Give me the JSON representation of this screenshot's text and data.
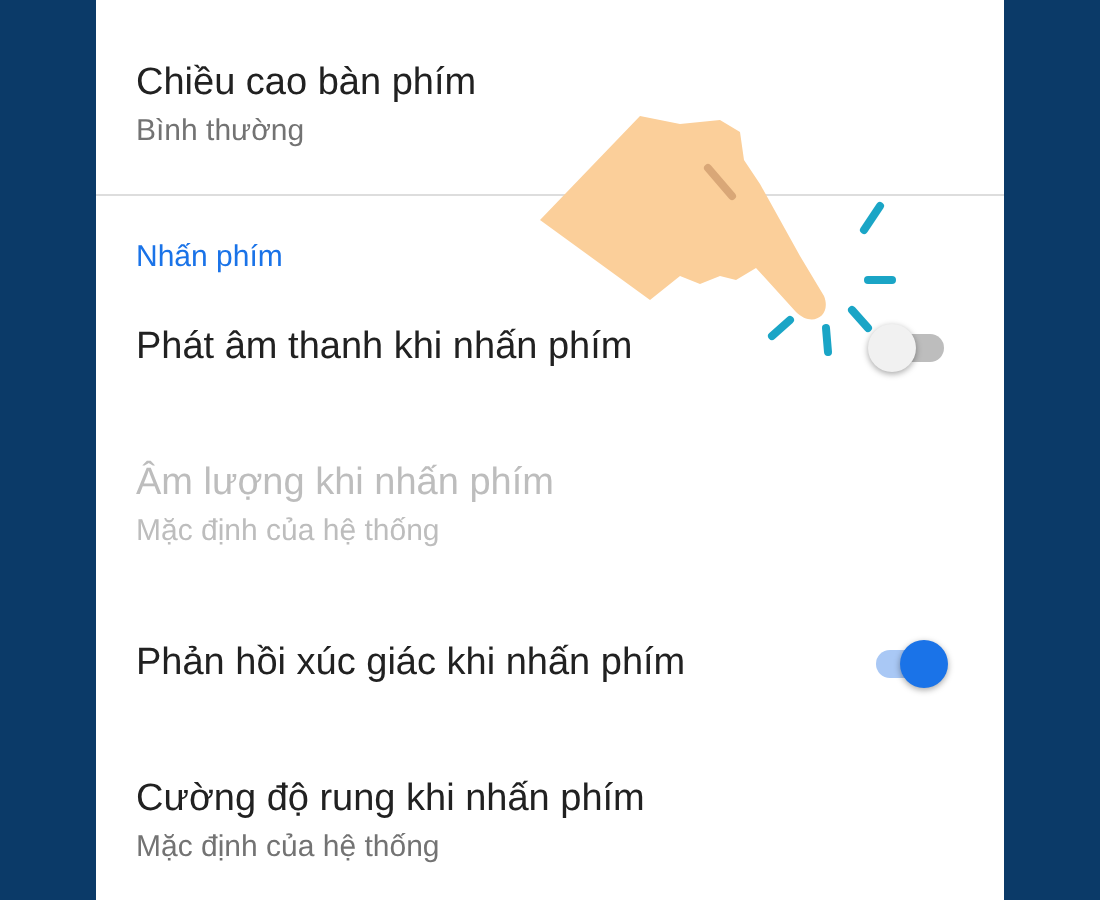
{
  "settings": [
    {
      "kind": "item",
      "title": "Chiều cao bàn phím",
      "subtitle": "Bình thường",
      "disabled": false,
      "divider": true
    },
    {
      "kind": "header",
      "title": "Nhấn phím"
    },
    {
      "kind": "switch",
      "title": "Phát âm thanh khi nhấn phím",
      "on": false
    },
    {
      "kind": "item",
      "title": "Âm lượng khi nhấn phím",
      "subtitle": "Mặc định của hệ thống",
      "disabled": true,
      "divider": false
    },
    {
      "kind": "switch",
      "title": "Phản hồi xúc giác khi nhấn phím",
      "on": true
    },
    {
      "kind": "item",
      "title": "Cường độ rung khi nhấn phím",
      "subtitle": "Mặc định của hệ thống",
      "disabled": false,
      "divider": false
    }
  ]
}
